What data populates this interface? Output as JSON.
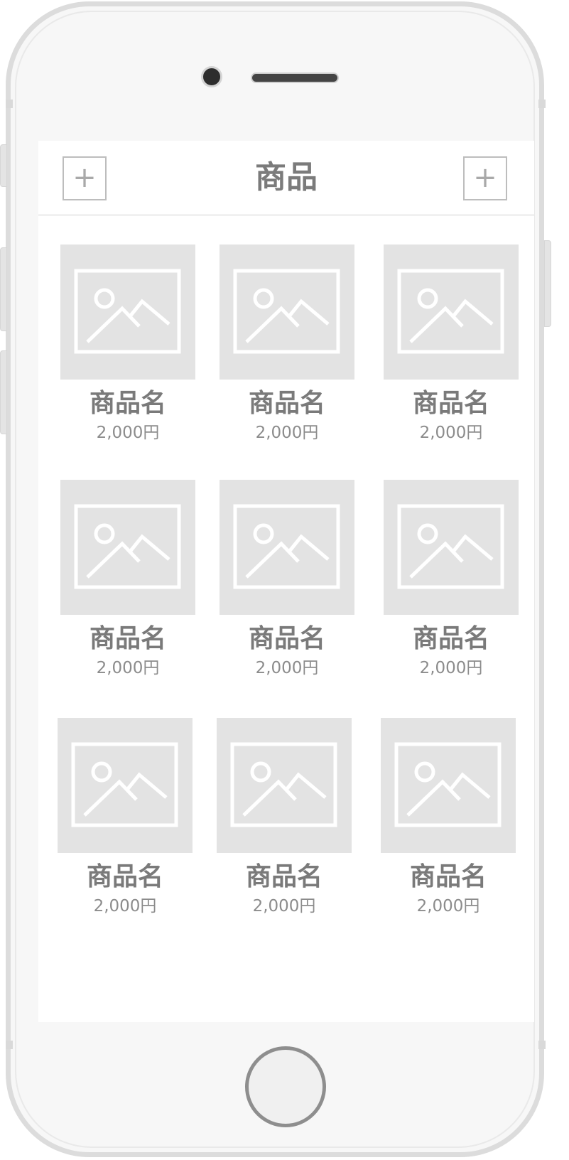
{
  "header": {
    "title": "商品",
    "left_button": "+",
    "right_button": "+"
  },
  "products": [
    {
      "name": "商品名",
      "price": "2,000円"
    },
    {
      "name": "商品名",
      "price": "2,000円"
    },
    {
      "name": "商品名",
      "price": "2,000円"
    },
    {
      "name": "商品名",
      "price": "2,000円"
    },
    {
      "name": "商品名",
      "price": "2,000円"
    },
    {
      "name": "商品名",
      "price": "2,000円"
    },
    {
      "name": "商品名",
      "price": "2,000円"
    },
    {
      "name": "商品名",
      "price": "2,000円"
    },
    {
      "name": "商品名",
      "price": "2,000円"
    }
  ],
  "icons": {
    "add": "plus-icon",
    "thumbnail": "image-placeholder-icon"
  },
  "colors": {
    "text": "#7a7a7a",
    "placeholder_bg": "#e3e3e3",
    "border": "#bdbdbd"
  }
}
